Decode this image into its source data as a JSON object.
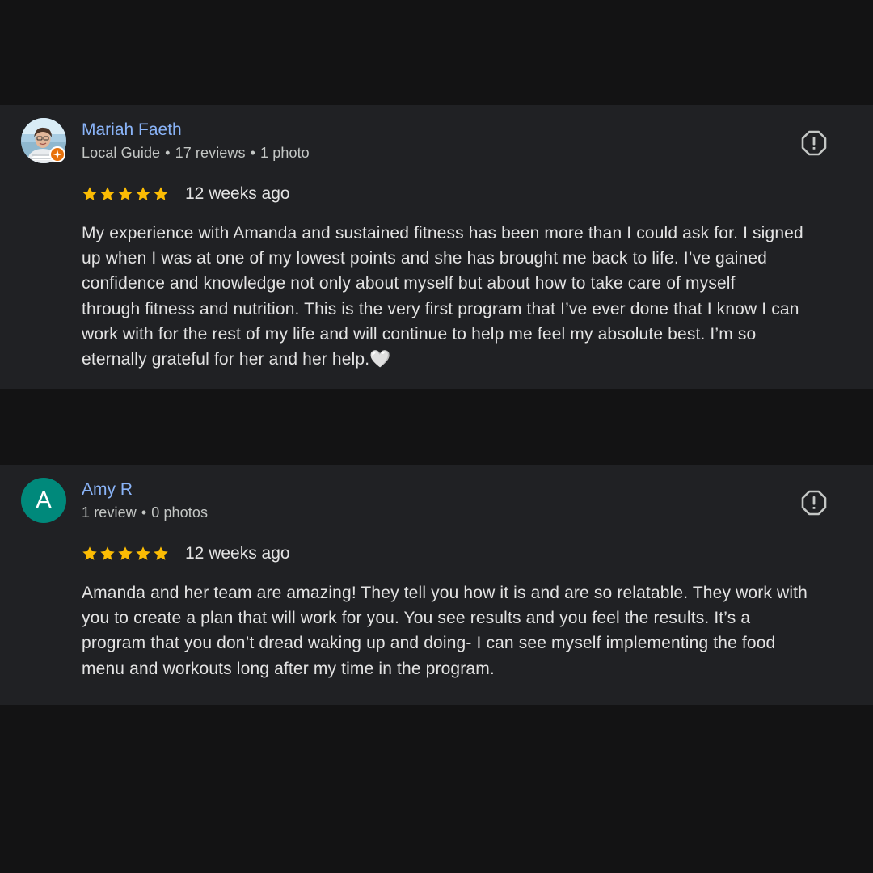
{
  "reviews": [
    {
      "name": "Mariah Faeth",
      "meta": [
        "Local Guide",
        "17 reviews",
        "1 photo"
      ],
      "meta_separator": "•",
      "avatar": "profile-photo",
      "badge_icon": "local-guide-badge-icon",
      "rating": 5,
      "time": "12 weeks ago",
      "text_lines": [
        "My experience with Amanda and sustained fitness has been more than I could ask for. I signed",
        "up when I was at one of my lowest points and she has brought me back to life. I’ve gained",
        "confidence and knowledge not only about myself but about how to take care of myself",
        "through fitness and nutrition. This is the very first program that I’ve ever done that I know I can",
        "work with for the rest of my life and will continue to help me feel my absolute best. I’m so",
        "eternally grateful for her and her help.🤍"
      ]
    },
    {
      "name": "Amy R",
      "meta": [
        "1 review",
        "0 photos"
      ],
      "meta_separator": "•",
      "avatar_letter": "A",
      "avatar_color": "#00897b",
      "rating": 5,
      "time": "12 weeks ago",
      "text_lines": [
        "Amanda and her team are amazing! They tell you how it is and are so relatable. They work with",
        "you to create a plan that will work for you. You see results and you feel the results. It’s a",
        "program that you don’t dread waking up and doing- I can see myself implementing the food",
        "menu and workouts long after my time in the program."
      ]
    }
  ],
  "colors": {
    "page_background": "#131314",
    "card_background": "#202124",
    "name_link": "#8ab4f8",
    "star": "#fbbc04",
    "text": "#e3e3e3",
    "secondary_text": "#c4c7c5"
  },
  "icons": {
    "flag": "report-flag-icon",
    "star": "star-icon"
  }
}
